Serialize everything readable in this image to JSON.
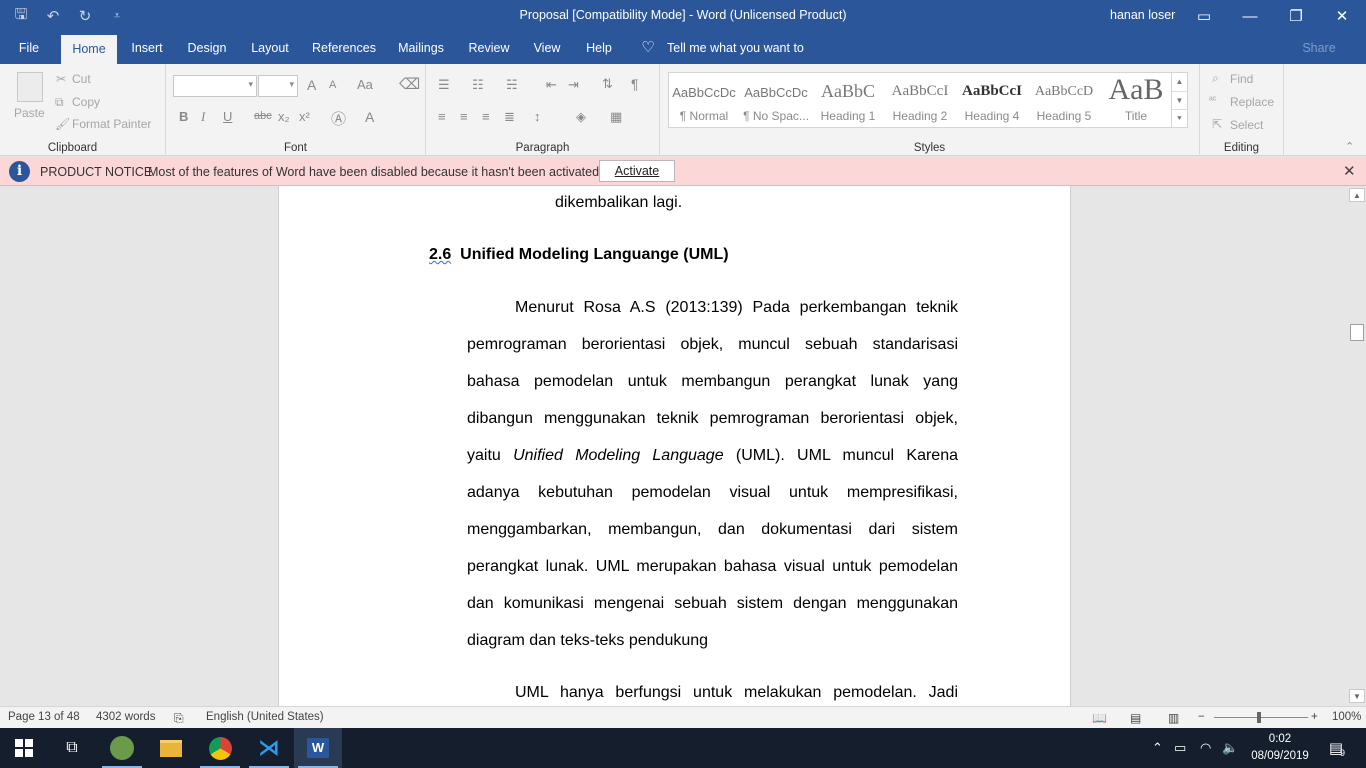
{
  "window": {
    "title": "Proposal [Compatibility Mode]  -  Word (Unlicensed Product)",
    "user": "hanan loser",
    "quick_access": [
      "save-icon",
      "undo-icon",
      "redo-icon",
      "customize-icon"
    ]
  },
  "ribbon_tabs": [
    "File",
    "Home",
    "Insert",
    "Design",
    "Layout",
    "References",
    "Mailings",
    "Review",
    "View",
    "Help"
  ],
  "active_tab": "Home",
  "tell_me": "Tell me what you want to do",
  "share_label": "Share",
  "clipboard": {
    "paste": "Paste",
    "cut": "Cut",
    "copy": "Copy",
    "format_painter": "Format Painter",
    "label": "Clipboard"
  },
  "font_group": {
    "label": "Font",
    "bold": "B",
    "italic": "I",
    "underline": "U",
    "strike": "abc",
    "subscript": "x₂",
    "superscript": "x²",
    "case": "Aa",
    "grow": "A",
    "shrink": "A",
    "font_color": "A"
  },
  "paragraph_group": {
    "label": "Paragraph"
  },
  "styles": {
    "label": "Styles",
    "items": [
      {
        "preview": "AaBbCcDc",
        "name": "¶ Normal"
      },
      {
        "preview": "AaBbCcDc",
        "name": "¶ No Spac..."
      },
      {
        "preview": "AaBbC",
        "name": "Heading 1"
      },
      {
        "preview": "AaBbCcI",
        "name": "Heading 2"
      },
      {
        "preview": "AaBbCcI",
        "name": "Heading 4"
      },
      {
        "preview": "AaBbCcD",
        "name": "Heading 5"
      },
      {
        "preview": "AaB",
        "name": "Title"
      }
    ]
  },
  "editing": {
    "label": "Editing",
    "find": "Find",
    "replace": "Replace",
    "select": "Select"
  },
  "notice": {
    "heading": "PRODUCT NOTICE",
    "message": "Most of the features of Word have been disabled because it hasn't been activated.",
    "button": "Activate"
  },
  "document": {
    "prev_line": "dikembalikan lagi.",
    "heading_number": "2.6",
    "heading_text": "Unified Modeling Languange (UML)",
    "para1_lines": [
      "Menurut Rosa A.S (2013:139) Pada perkembangan teknik",
      "pemrograman berorientasi objek, muncul sebuah standarisasi",
      "bahasa pemodelan untuk membangun perangkat lunak yang",
      "dibangun menggunakan teknik pemrograman berorientasi objek,",
      "yaitu Unified Modeling Language (UML). UML muncul Karena",
      "adanya kebutuhan pemodelan visual untuk mempresifikasi,",
      "menggambarkan, membangun, dan dokumentasi dari sistem",
      "perangkat lunak. UML merupakan bahasa visual untuk pemodelan",
      "dan komunikasi mengenai sebuah sistem dengan menggunakan",
      "diagram dan teks-teks pendukung"
    ],
    "para2_line": "UML hanya berfungsi untuk melakukan pemodelan. Jadi"
  },
  "status": {
    "page": "Page 13 of 48",
    "words": "4302 words",
    "language": "English (United States)",
    "zoom": "100%"
  },
  "taskbar": {
    "time": "0:02",
    "date": "08/09/2019",
    "notifications": "9"
  }
}
